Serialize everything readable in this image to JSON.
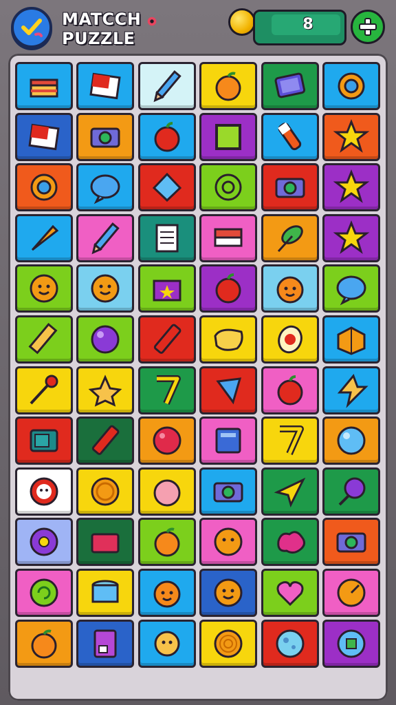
{
  "header": {
    "title_line1": "MATCCH",
    "title_line2": "PUZZLE",
    "score": "8",
    "menu_button": "check-mark-icon",
    "add_button": "plus-icon"
  },
  "board": {
    "rows": 12,
    "cols": 6,
    "tiles": [
      {
        "color": "#1fa9ee",
        "icon": "cake-icon"
      },
      {
        "color": "#1fa9ee",
        "icon": "red-card-icon"
      },
      {
        "color": "#d4f3f7",
        "icon": "pencil-icon"
      },
      {
        "color": "#f7d60d",
        "icon": "orange-fruit-icon"
      },
      {
        "color": "#1e9a49",
        "icon": "tablet-icon"
      },
      {
        "color": "#1fa9ee",
        "icon": "gear-icon"
      },
      {
        "color": "#2a63c9",
        "icon": "red-card-icon"
      },
      {
        "color": "#f39a14",
        "icon": "camera-icon"
      },
      {
        "color": "#1fa9ee",
        "icon": "apple-icon"
      },
      {
        "color": "#9c2fc6",
        "icon": "square-frame-icon"
      },
      {
        "color": "#1fa9ee",
        "icon": "bottle-icon"
      },
      {
        "color": "#f05a1c",
        "icon": "star-icon"
      },
      {
        "color": "#f05a1c",
        "icon": "gear-icon"
      },
      {
        "color": "#1fa9ee",
        "icon": "bubble-icon"
      },
      {
        "color": "#e02a1e",
        "icon": "diamond-icon"
      },
      {
        "color": "#7ccf1c",
        "icon": "snail-icon"
      },
      {
        "color": "#e02a1e",
        "icon": "camera-icon"
      },
      {
        "color": "#9c2fc6",
        "icon": "star-icon"
      },
      {
        "color": "#1fa9ee",
        "icon": "carrot-icon"
      },
      {
        "color": "#f05fc4",
        "icon": "pencil-icon"
      },
      {
        "color": "#1a8f7c",
        "icon": "notepad-icon"
      },
      {
        "color": "#f05fc4",
        "icon": "book-icon"
      },
      {
        "color": "#f39a14",
        "icon": "leaf-icon"
      },
      {
        "color": "#9c2fc6",
        "icon": "star-icon"
      },
      {
        "color": "#7ccf1c",
        "icon": "cookie-face-icon"
      },
      {
        "color": "#7ad0ef",
        "icon": "cookie-face-icon"
      },
      {
        "color": "#7ccf1c",
        "icon": "gift-box-icon"
      },
      {
        "color": "#9c2fc6",
        "icon": "apple-icon"
      },
      {
        "color": "#7ad0ef",
        "icon": "orange-face-icon"
      },
      {
        "color": "#7ccf1c",
        "icon": "bubble-icon"
      },
      {
        "color": "#7ccf1c",
        "icon": "gold-bar-icon"
      },
      {
        "color": "#7ccf1c",
        "icon": "purple-ball-icon"
      },
      {
        "color": "#e02a1e",
        "icon": "crayon-icon"
      },
      {
        "color": "#f7d60d",
        "icon": "cheese-icon"
      },
      {
        "color": "#f7d60d",
        "icon": "egg-icon"
      },
      {
        "color": "#1fa9ee",
        "icon": "crate-icon"
      },
      {
        "color": "#f7d60d",
        "icon": "pin-icon"
      },
      {
        "color": "#f7d60d",
        "icon": "star-face-icon"
      },
      {
        "color": "#1e9a49",
        "icon": "seven-icon"
      },
      {
        "color": "#e02a1e",
        "icon": "kite-icon"
      },
      {
        "color": "#f05fc4",
        "icon": "apple-icon"
      },
      {
        "color": "#1fa9ee",
        "icon": "lightning-star-icon"
      },
      {
        "color": "#e02a1e",
        "icon": "safe-icon"
      },
      {
        "color": "#1a6f3c",
        "icon": "crayon-icon"
      },
      {
        "color": "#f39a14",
        "icon": "red-ball-icon"
      },
      {
        "color": "#f05fc4",
        "icon": "window-icon"
      },
      {
        "color": "#f7d60d",
        "icon": "seven-icon"
      },
      {
        "color": "#f39a14",
        "icon": "blue-ball-icon"
      },
      {
        "color": "#ffffff",
        "icon": "ghost-face-icon"
      },
      {
        "color": "#f7d60d",
        "icon": "orange-coin-icon"
      },
      {
        "color": "#f7d60d",
        "icon": "peach-icon"
      },
      {
        "color": "#1fa9ee",
        "icon": "camera-icon"
      },
      {
        "color": "#1e9a49",
        "icon": "paper-plane-icon"
      },
      {
        "color": "#1e9a49",
        "icon": "lollipop-icon"
      },
      {
        "color": "#9fb4f5",
        "icon": "donut-icon"
      },
      {
        "color": "#1a6f3c",
        "icon": "red-box-icon"
      },
      {
        "color": "#7ccf1c",
        "icon": "orange-fruit-icon"
      },
      {
        "color": "#f05fc4",
        "icon": "cookie-icon"
      },
      {
        "color": "#1e9a49",
        "icon": "splat-icon"
      },
      {
        "color": "#f05a1c",
        "icon": "camera-icon"
      },
      {
        "color": "#f05fc4",
        "icon": "swirl-ball-icon"
      },
      {
        "color": "#f7d60d",
        "icon": "drum-icon"
      },
      {
        "color": "#1fa9ee",
        "icon": "orange-face-icon"
      },
      {
        "color": "#2a63c9",
        "icon": "cookie-face-icon"
      },
      {
        "color": "#7ccf1c",
        "icon": "heart-gem-icon"
      },
      {
        "color": "#f05fc4",
        "icon": "compass-icon"
      },
      {
        "color": "#f39a14",
        "icon": "orange-fruit-icon"
      },
      {
        "color": "#2a63c9",
        "icon": "card-icon"
      },
      {
        "color": "#1fa9ee",
        "icon": "sun-face-icon"
      },
      {
        "color": "#f7d60d",
        "icon": "spiral-icon"
      },
      {
        "color": "#e02a1e",
        "icon": "moon-ball-icon"
      },
      {
        "color": "#9c2fc6",
        "icon": "badge-icon"
      }
    ]
  }
}
